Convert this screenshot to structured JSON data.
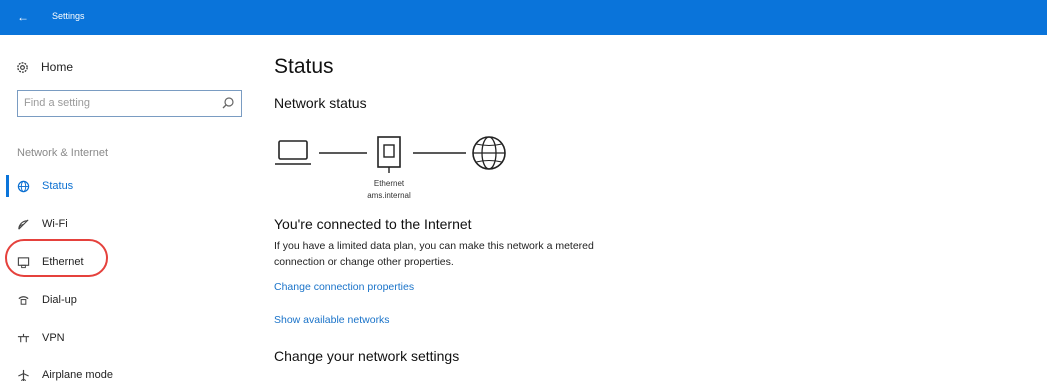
{
  "window": {
    "title": "Settings",
    "back_icon": "back-arrow-icon",
    "accent": "#0a74da"
  },
  "sidebar": {
    "home_label": "Home",
    "search_placeholder": "Find a setting",
    "section_label": "Network & Internet",
    "items": [
      {
        "label": "Status",
        "icon": "status-globe-icon",
        "active": true
      },
      {
        "label": "Wi-Fi",
        "icon": "wifi-icon",
        "active": false
      },
      {
        "label": "Ethernet",
        "icon": "ethernet-icon",
        "active": false,
        "highlighted": true
      },
      {
        "label": "Dial-up",
        "icon": "dialup-icon",
        "active": false
      },
      {
        "label": "VPN",
        "icon": "vpn-icon",
        "active": false
      },
      {
        "label": "Airplane mode",
        "icon": "airplane-icon",
        "active": false
      }
    ],
    "highlight_color": "#e5413c"
  },
  "main": {
    "title": "Status",
    "network_status_heading": "Network status",
    "diagram": {
      "adapter_label": "Ethernet",
      "network_name": "ams.internal"
    },
    "connected_heading": "You're connected to the Internet",
    "connected_desc": "If you have a limited data plan, you can make this network a metered connection or change other properties.",
    "links": [
      "Change connection properties",
      "Show available networks"
    ],
    "change_heading": "Change your network settings",
    "link_color": "#1a73c9"
  }
}
